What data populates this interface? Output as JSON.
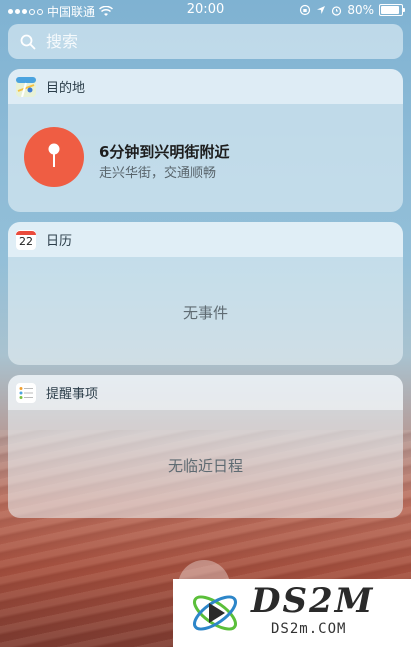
{
  "status_bar": {
    "carrier": "中国联通",
    "time": "20:00",
    "battery": "80%",
    "battery_level": 0.8,
    "icons": [
      "signal-dots-icon",
      "wifi-icon",
      "orientation-lock-icon",
      "location-arrow-icon",
      "alarm-icon",
      "battery-icon"
    ]
  },
  "search": {
    "placeholder": "搜索"
  },
  "widgets": {
    "destination": {
      "title": "目的地",
      "icon": "maps-icon",
      "main": "6分钟到兴明街附近",
      "sub": "走兴华街，交通顺畅",
      "pin_color": "#ef5d43"
    },
    "calendar": {
      "title": "日历",
      "icon_day": "22",
      "empty": "无事件"
    },
    "reminders": {
      "title": "提醒事项",
      "icon": "reminders-icon",
      "empty": "无临近日程"
    }
  },
  "watermark": {
    "brand": "DS2M",
    "domain": "DS2m.COM"
  }
}
